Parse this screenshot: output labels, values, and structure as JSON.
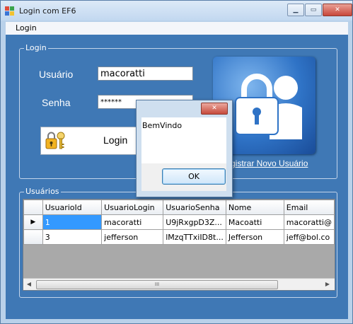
{
  "window": {
    "title": "Login com EF6"
  },
  "menu": {
    "items": [
      "Login"
    ]
  },
  "login_group": {
    "title": "Login",
    "user_label": "Usuário",
    "user_value": "macoratti",
    "password_label": "Senha",
    "password_value": "******",
    "login_button": "Login",
    "register_link": "Registrar Novo Usuário",
    "register_link_visible": "gistrar Novo Usuário"
  },
  "users_group": {
    "title": "Usuários",
    "columns": [
      "UsuarioId",
      "UsuarioLogin",
      "UsuarioSenha",
      "Nome",
      "Email"
    ],
    "rows": [
      [
        "1",
        "macoratti",
        "U9jRxgpD3Z...",
        "Macoatti",
        "macoratti@"
      ],
      [
        "3",
        "jefferson",
        "lMzqTTxiID8t...",
        "Jefferson",
        "jeff@bol.co"
      ]
    ],
    "scroll_grip": "III"
  },
  "dialog": {
    "message": "BemVindo",
    "ok_label": "OK",
    "close_glyph": "✕"
  },
  "icons": {
    "app": "app-icon",
    "lock_user": "lock-user-icon",
    "key": "key-lock-icon"
  },
  "colors": {
    "accent": "#3f78b5",
    "selection": "#3399ff"
  }
}
